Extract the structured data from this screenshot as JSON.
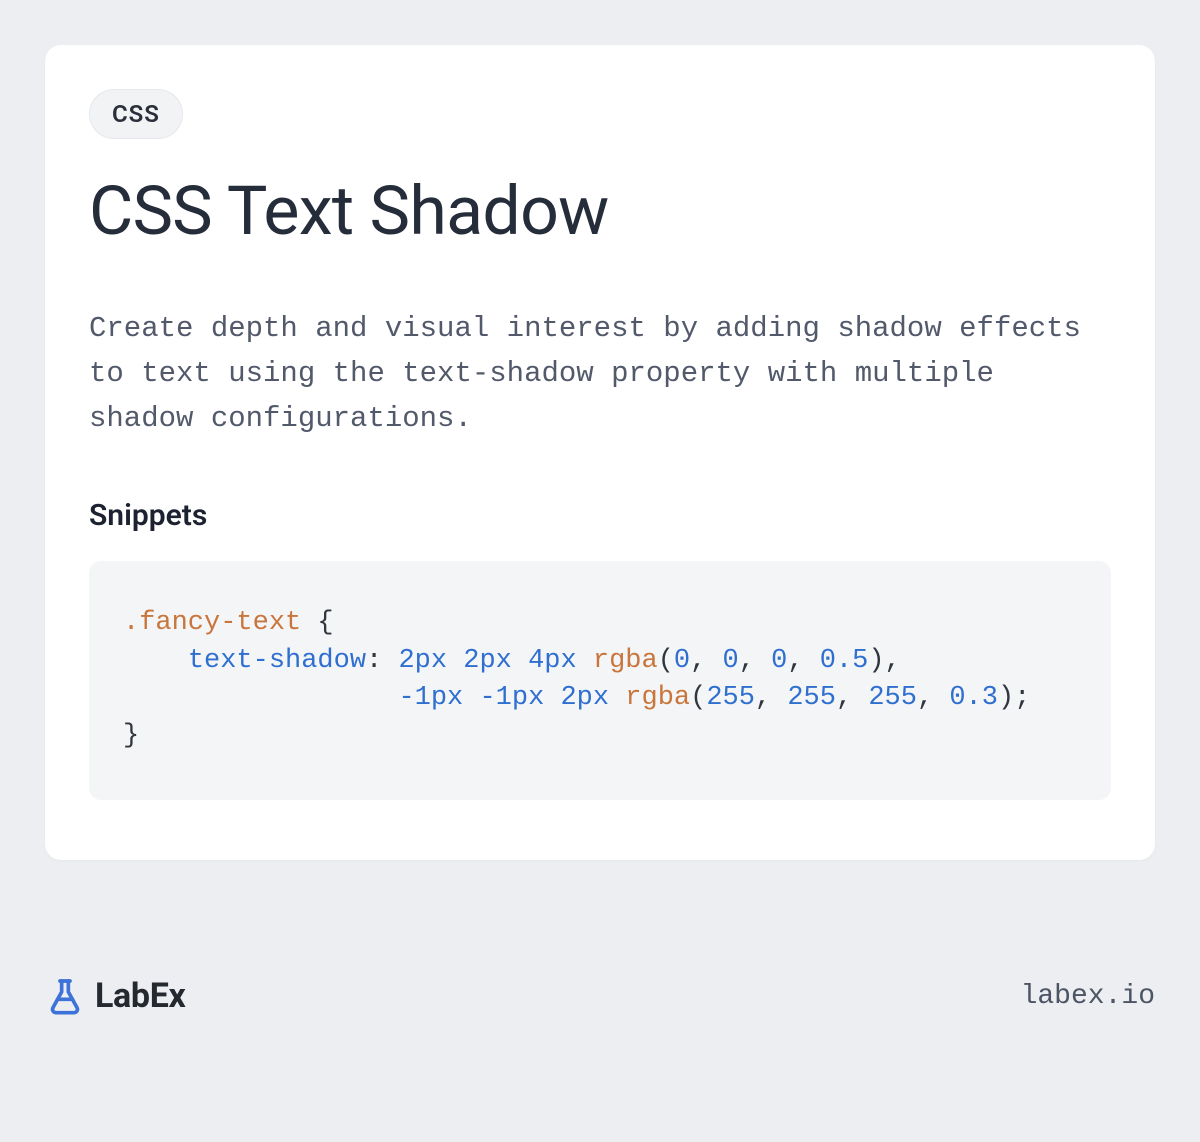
{
  "tag": "CSS",
  "title": "CSS Text Shadow",
  "description": "Create depth and visual interest by adding shadow effects to text using the text-shadow property with multiple shadow configurations.",
  "section_heading": "Snippets",
  "code": {
    "selector": ".fancy-text",
    "open_brace": " {",
    "indent1": "    ",
    "property": "text-shadow",
    "colon_space": ": ",
    "val_2px_a": "2px",
    "sp": " ",
    "val_2px_b": "2px",
    "val_4px": "4px",
    "rgba": "rgba",
    "open_paren": "(",
    "n0a": "0",
    "comma_sp": ", ",
    "n0b": "0",
    "n0c": "0",
    "n05": "0.5",
    "close_paren": ")",
    "comma": ",",
    "indent2": "                 ",
    "val_neg1a": "-1px",
    "val_neg1b": "-1px",
    "val_2px_c": "2px",
    "n255a": "255",
    "n255b": "255",
    "n255c": "255",
    "n03": "0.3",
    "semicolon": ";",
    "close_brace": "}"
  },
  "brand": {
    "name": "LabEx"
  },
  "site": "labex.io"
}
